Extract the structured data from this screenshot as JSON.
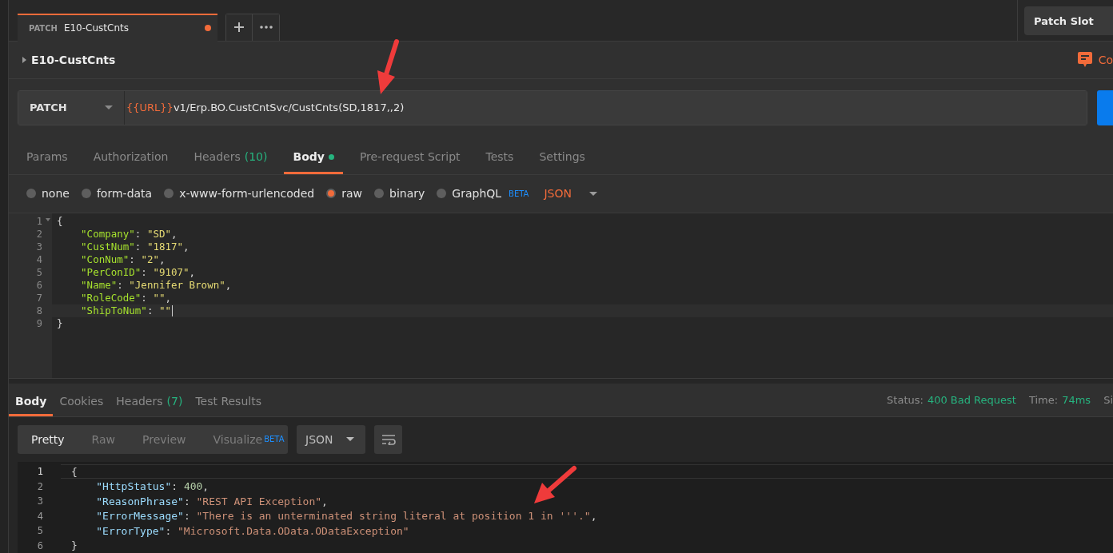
{
  "request_tab": {
    "method": "PATCH",
    "name": "E10-CustCnts",
    "unsaved": true
  },
  "environment": {
    "label": "Patch Slot"
  },
  "request": {
    "title": "E10-CustCnts",
    "comments_label": "Co"
  },
  "url_bar": {
    "method": "PATCH",
    "variable": "{{URL}}",
    "path": "v1/Erp.BO.CustCntSvc/CustCnts(SD,1817,,2)"
  },
  "request_tabs": [
    {
      "label": "Params",
      "selected": false,
      "has_content": false
    },
    {
      "label": "Authorization",
      "selected": false,
      "has_content": false
    },
    {
      "label": "Headers",
      "count": "(10)",
      "selected": false,
      "has_content": false
    },
    {
      "label": "Body",
      "selected": true,
      "has_content": true
    },
    {
      "label": "Pre-request Script",
      "selected": false,
      "has_content": false
    },
    {
      "label": "Tests",
      "selected": false,
      "has_content": false
    },
    {
      "label": "Settings",
      "selected": false,
      "has_content": false
    }
  ],
  "body_types": [
    {
      "label": "none",
      "selected": false
    },
    {
      "label": "form-data",
      "selected": false
    },
    {
      "label": "x-www-form-urlencoded",
      "selected": false
    },
    {
      "label": "raw",
      "selected": true
    },
    {
      "label": "binary",
      "selected": false
    },
    {
      "label": "GraphQL",
      "badge": "BETA",
      "selected": false
    }
  ],
  "body_format": "JSON",
  "request_body": [
    {
      "number": "1",
      "current": false,
      "tokens": [
        {
          "kind": "punct",
          "text": "{"
        }
      ]
    },
    {
      "number": "2",
      "current": false,
      "tokens": [
        {
          "kind": "key",
          "text": "\"Company\""
        },
        {
          "kind": "punct",
          "text": ": "
        },
        {
          "kind": "string",
          "text": "\"SD\""
        },
        {
          "kind": "punct",
          "text": ","
        }
      ]
    },
    {
      "number": "3",
      "current": false,
      "tokens": [
        {
          "kind": "key",
          "text": "\"CustNum\""
        },
        {
          "kind": "punct",
          "text": ": "
        },
        {
          "kind": "string",
          "text": "\"1817\""
        },
        {
          "kind": "punct",
          "text": ","
        }
      ]
    },
    {
      "number": "4",
      "current": false,
      "tokens": [
        {
          "kind": "key",
          "text": "\"ConNum\""
        },
        {
          "kind": "punct",
          "text": ": "
        },
        {
          "kind": "string",
          "text": "\"2\""
        },
        {
          "kind": "punct",
          "text": ","
        }
      ]
    },
    {
      "number": "5",
      "current": false,
      "tokens": [
        {
          "kind": "key",
          "text": "\"PerConID\""
        },
        {
          "kind": "punct",
          "text": ": "
        },
        {
          "kind": "string",
          "text": "\"9107\""
        },
        {
          "kind": "punct",
          "text": ","
        }
      ]
    },
    {
      "number": "6",
      "current": false,
      "tokens": [
        {
          "kind": "key",
          "text": "\"Name\""
        },
        {
          "kind": "punct",
          "text": ": "
        },
        {
          "kind": "string",
          "text": "\"Jennifer Brown\""
        },
        {
          "kind": "punct",
          "text": ","
        }
      ]
    },
    {
      "number": "7",
      "current": false,
      "tokens": [
        {
          "kind": "key",
          "text": "\"RoleCode\""
        },
        {
          "kind": "punct",
          "text": ": "
        },
        {
          "kind": "string",
          "text": "\"\""
        },
        {
          "kind": "punct",
          "text": ","
        }
      ]
    },
    {
      "number": "8",
      "current": true,
      "tokens": [
        {
          "kind": "key",
          "text": "\"ShipToNum\""
        },
        {
          "kind": "punct",
          "text": ": "
        },
        {
          "kind": "string",
          "text": "\"\""
        }
      ]
    },
    {
      "number": "9",
      "current": false,
      "tokens": [
        {
          "kind": "punct",
          "text": "}"
        }
      ]
    }
  ],
  "response_tabs": [
    {
      "label": "Body",
      "selected": true
    },
    {
      "label": "Cookies",
      "selected": false
    },
    {
      "label": "Headers",
      "count": "(7)",
      "selected": false
    },
    {
      "label": "Test Results",
      "selected": false
    }
  ],
  "response_meta": [
    {
      "label": "Status:",
      "value": "400 Bad Request"
    },
    {
      "label": "Time:",
      "value": "74ms"
    },
    {
      "label": "Si"
    }
  ],
  "view_modes": [
    {
      "label": "Pretty",
      "selected": true
    },
    {
      "label": "Raw",
      "selected": false
    },
    {
      "label": "Preview",
      "selected": false
    },
    {
      "label": "Visualize",
      "badge": "BETA",
      "selected": false
    }
  ],
  "response_format": "JSON",
  "response_body": [
    {
      "number": "1",
      "current": true,
      "tokens": [
        {
          "kind": "punct",
          "text": "{"
        }
      ]
    },
    {
      "number": "2",
      "current": false,
      "tokens": [
        {
          "kind": "key",
          "text": "\"HttpStatus\""
        },
        {
          "kind": "punct",
          "text": ": "
        },
        {
          "kind": "number",
          "text": "400"
        },
        {
          "kind": "punct",
          "text": ","
        }
      ]
    },
    {
      "number": "3",
      "current": false,
      "tokens": [
        {
          "kind": "key",
          "text": "\"ReasonPhrase\""
        },
        {
          "kind": "punct",
          "text": ": "
        },
        {
          "kind": "string",
          "text": "\"REST API Exception\""
        },
        {
          "kind": "punct",
          "text": ","
        }
      ]
    },
    {
      "number": "4",
      "current": false,
      "tokens": [
        {
          "kind": "key",
          "text": "\"ErrorMessage\""
        },
        {
          "kind": "punct",
          "text": ": "
        },
        {
          "kind": "string",
          "text": "\"There is an unterminated string literal at position 1 in '''.\""
        },
        {
          "kind": "punct",
          "text": ","
        }
      ]
    },
    {
      "number": "5",
      "current": false,
      "tokens": [
        {
          "kind": "key",
          "text": "\"ErrorType\""
        },
        {
          "kind": "punct",
          "text": ": "
        },
        {
          "kind": "string",
          "text": "\"Microsoft.Data.OData.ODataException\""
        }
      ]
    },
    {
      "number": "6",
      "current": false,
      "tokens": [
        {
          "kind": "punct",
          "text": "}"
        }
      ]
    }
  ]
}
